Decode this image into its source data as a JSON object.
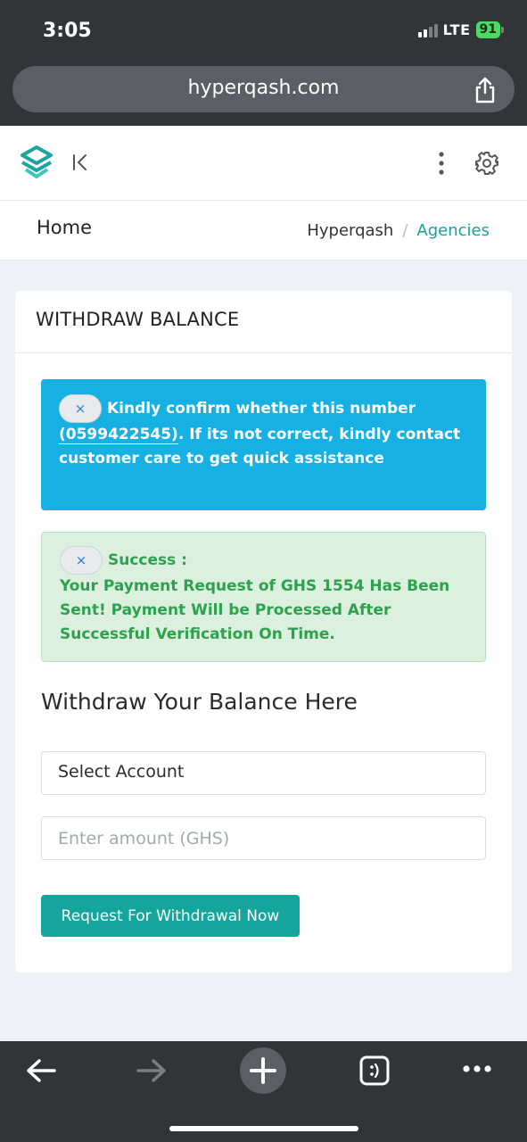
{
  "status_bar": {
    "time": "3:05",
    "network": "LTE",
    "battery": "91"
  },
  "browser": {
    "url": "hyperqash.com"
  },
  "header": {
    "page_title": "Home",
    "breadcrumb": {
      "root": "Hyperqash",
      "separator": "/",
      "current": "Agencies"
    }
  },
  "card": {
    "title": "WITHDRAW BALANCE",
    "info_alert": {
      "close_label": "×",
      "text_before": "Kindly confirm whether this number",
      "number": "(0599422545)",
      "text_after": ". If its not correct, kindly contact customer care to get quick assistance"
    },
    "success_alert": {
      "close_label": "×",
      "heading": "Success :",
      "message": "Your Payment Request of GHS 1554 Has Been Sent! Payment Will be Processed After Successful Verification On Time."
    },
    "form": {
      "title": "Withdraw Your Balance Here",
      "select_value": "Select Account",
      "amount_placeholder": "Enter amount (GHS)",
      "submit_label": "Request For Withdrawal Now"
    }
  },
  "colors": {
    "accent": "#14a69c",
    "info": "#17b0e2",
    "success_text": "#2ea14c",
    "success_bg": "#dbf0df"
  },
  "icons": [
    "share-icon",
    "logo-icon",
    "collapse-icon",
    "kebab-icon",
    "gear-icon",
    "back-icon",
    "forward-icon",
    "new-tab-icon",
    "tabs-icon",
    "more-icon"
  ]
}
